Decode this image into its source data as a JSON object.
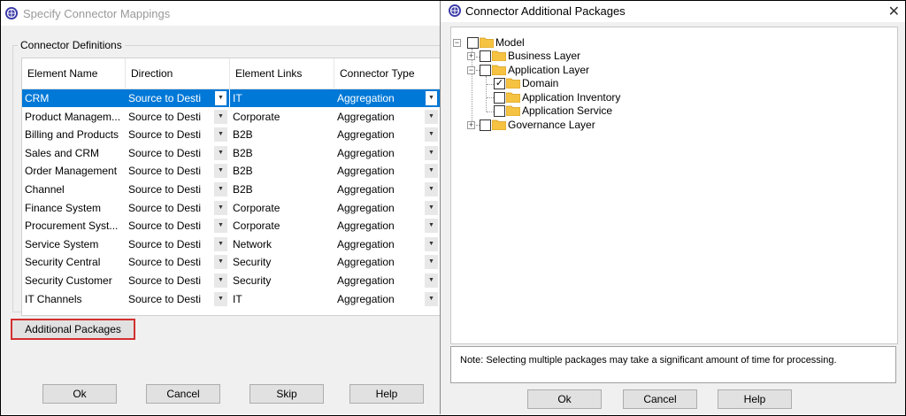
{
  "left_window": {
    "title": "Specify Connector Mappings",
    "group_label": "Connector Definitions",
    "columns": [
      "Element Name",
      "Direction",
      "Element Links",
      "Connector Type"
    ],
    "rows": [
      {
        "name": "CRM",
        "direction": "Source to Desti",
        "link": "IT",
        "type": "Aggregation",
        "selected": true
      },
      {
        "name": "Product Managem...",
        "direction": "Source to Desti",
        "link": "Corporate",
        "type": "Aggregation"
      },
      {
        "name": "Billing and Products",
        "direction": "Source to Desti",
        "link": "B2B",
        "type": "Aggregation"
      },
      {
        "name": "Sales and CRM",
        "direction": "Source to Desti",
        "link": "B2B",
        "type": "Aggregation"
      },
      {
        "name": "Order Management",
        "direction": "Source to Desti",
        "link": "B2B",
        "type": "Aggregation"
      },
      {
        "name": "Channel",
        "direction": "Source to Desti",
        "link": "B2B",
        "type": "Aggregation"
      },
      {
        "name": "Finance System",
        "direction": "Source to Desti",
        "link": "Corporate",
        "type": "Aggregation"
      },
      {
        "name": "Procurement Syst...",
        "direction": "Source to Desti",
        "link": "Corporate",
        "type": "Aggregation"
      },
      {
        "name": "Service System",
        "direction": "Source to Desti",
        "link": "Network",
        "type": "Aggregation"
      },
      {
        "name": "Security Central",
        "direction": "Source to Desti",
        "link": "Security",
        "type": "Aggregation"
      },
      {
        "name": "Security Customer",
        "direction": "Source to Desti",
        "link": "Security",
        "type": "Aggregation"
      },
      {
        "name": "IT Channels",
        "direction": "Source to Desti",
        "link": "IT",
        "type": "Aggregation"
      }
    ],
    "additional_packages_label": "Additional Packages",
    "buttons": {
      "ok": "Ok",
      "cancel": "Cancel",
      "skip": "Skip",
      "help": "Help"
    }
  },
  "right_window": {
    "title": "Connector Additional Packages",
    "tree": {
      "model": "Model",
      "business_layer": "Business Layer",
      "application_layer": "Application Layer",
      "domain": "Domain",
      "application_inventory": "Application Inventory",
      "application_service": "Application Service",
      "governance_layer": "Governance Layer"
    },
    "note": "Note: Selecting multiple packages may take a significant amount of time for processing.",
    "buttons": {
      "ok": "Ok",
      "cancel": "Cancel",
      "help": "Help"
    }
  },
  "colors": {
    "selection": "#0078d7",
    "highlight_border": "#d32f2f",
    "folder": "#f5c242"
  }
}
